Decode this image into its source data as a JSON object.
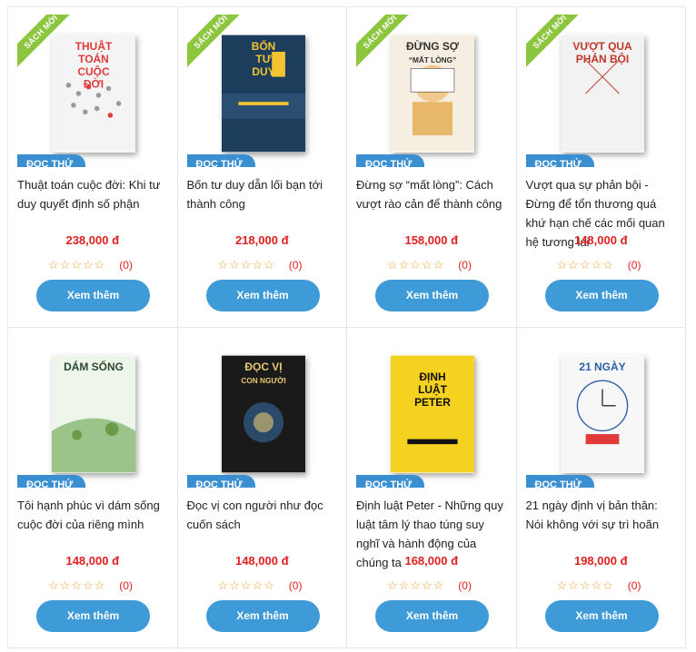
{
  "labels": {
    "new": "SÁCH MỚI",
    "try_read": "ĐỌC THỬ",
    "more": "Xem thêm"
  },
  "colors": {
    "accent": "#3e9bd8",
    "price": "#e02020",
    "ribbon": "#8cc63f",
    "star": "#f0a030"
  },
  "products": [
    {
      "title": "Thuật toán cuộc đời: Khi tư duy quyết định số phận",
      "price": "238,000 đ",
      "rating_count": "(0)",
      "is_new": true,
      "cover": {
        "text": [
          "THUẬT",
          "TOÁN",
          "CUỘC",
          "ĐỜI"
        ],
        "bg": "#f4f4f4",
        "fg": "#e03a3a"
      }
    },
    {
      "title": "Bốn tư duy dẫn lối bạn tới thành công",
      "price": "218,000 đ",
      "rating_count": "(0)",
      "is_new": true,
      "cover": {
        "text": [
          "BỐN",
          "TƯ",
          "DUY"
        ],
        "bg": "#1d3d5c",
        "fg": "#f4c430"
      }
    },
    {
      "title": "Đừng sợ “mất lòng”: Cách vượt rào cản để thành công",
      "price": "158,000 đ",
      "rating_count": "(0)",
      "is_new": true,
      "cover": {
        "text": [
          "ĐỪNG SỢ",
          "“MẤT LÒNG”"
        ],
        "bg": "#f6eee0",
        "fg": "#333333"
      }
    },
    {
      "title": "Vượt qua sự phản bội - Đừng để tổn thương quá khứ hạn chế các mối quan hệ tương lai",
      "price": "148,000 đ",
      "rating_count": "(0)",
      "is_new": true,
      "cover": {
        "text": [
          "VƯỢT QUA",
          "PHẢN BỘI"
        ],
        "bg": "#f2f2f2",
        "fg": "#c0392b"
      }
    },
    {
      "title": "Tôi hạnh phúc vì dám sống cuộc đời của riêng mình",
      "price": "148,000 đ",
      "rating_count": "(0)",
      "is_new": false,
      "cover": {
        "text": [
          "DÁM SỐNG"
        ],
        "bg": "#eef5ea",
        "fg": "#2d4a2d"
      }
    },
    {
      "title": "Đọc vị con người như đọc cuốn sách",
      "price": "148,000 đ",
      "rating_count": "(0)",
      "is_new": false,
      "cover": {
        "text": [
          "ĐỌC VỊ",
          "CON NGƯỜI"
        ],
        "bg": "#1a1a1a",
        "fg": "#e8c870"
      }
    },
    {
      "title": "Định luật Peter - Những quy luật tâm lý thao túng suy nghĩ và hành động của chúng ta",
      "price": "168,000 đ",
      "rating_count": "(0)",
      "is_new": false,
      "cover": {
        "text": [
          "ĐỊNH",
          "LUẬT",
          "PETER"
        ],
        "bg": "#f5d21f",
        "fg": "#111111"
      }
    },
    {
      "title": "21 ngày định vị bản thân: Nói không với sự trì hoãn",
      "price": "198,000 đ",
      "rating_count": "(0)",
      "is_new": false,
      "cover": {
        "text": [
          "21 NGÀY"
        ],
        "bg": "#f7f7f7",
        "fg": "#2a5fa8"
      }
    }
  ]
}
